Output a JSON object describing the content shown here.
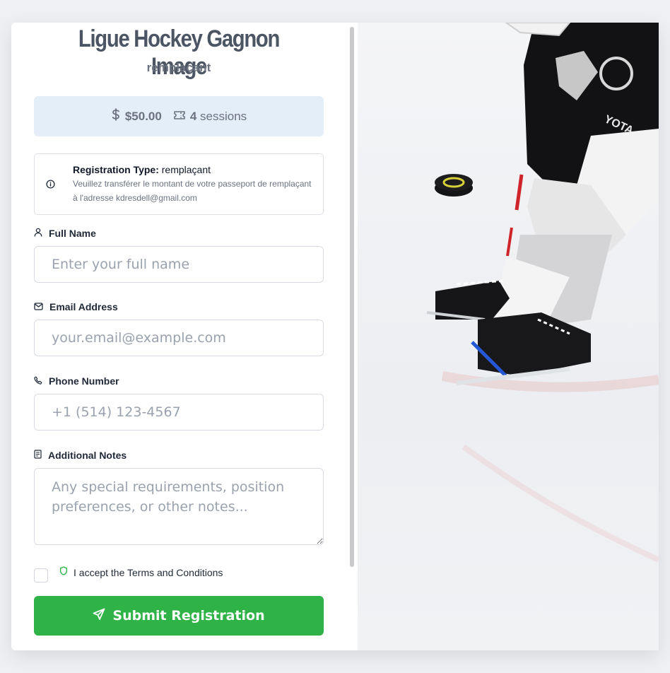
{
  "header": {
    "title": "Ligue Hockey Gagnon Image",
    "subtitle": "remplaçant"
  },
  "pricing": {
    "price": "$50.00",
    "sessions_count": "4",
    "sessions_label": "sessions",
    "dollar_icon": "dollar-icon",
    "ticket_icon": "ticket-icon"
  },
  "info": {
    "type_label": "Registration Type:",
    "type_value": " remplaçant",
    "message": "Veuillez transférer le montant de votre passeport de remplaçant à l'adresse kdresdell@gmail.com"
  },
  "form": {
    "full_name": {
      "label": "Full Name",
      "placeholder": "Enter your full name",
      "value": ""
    },
    "email": {
      "label": "Email Address",
      "placeholder": "your.email@example.com",
      "value": ""
    },
    "phone": {
      "label": "Phone Number",
      "placeholder": "+1 (514) 123-4567",
      "value": ""
    },
    "notes": {
      "label": "Additional Notes",
      "placeholder": "Any special requirements, position preferences, or other notes...",
      "value": ""
    }
  },
  "terms": {
    "label": "I accept the Terms and Conditions",
    "checked": false
  },
  "submit": {
    "label": "Submit Registration"
  },
  "colors": {
    "accent_green": "#2fb346",
    "price_bg": "#e3eef9",
    "title_gray": "#4b5563"
  }
}
